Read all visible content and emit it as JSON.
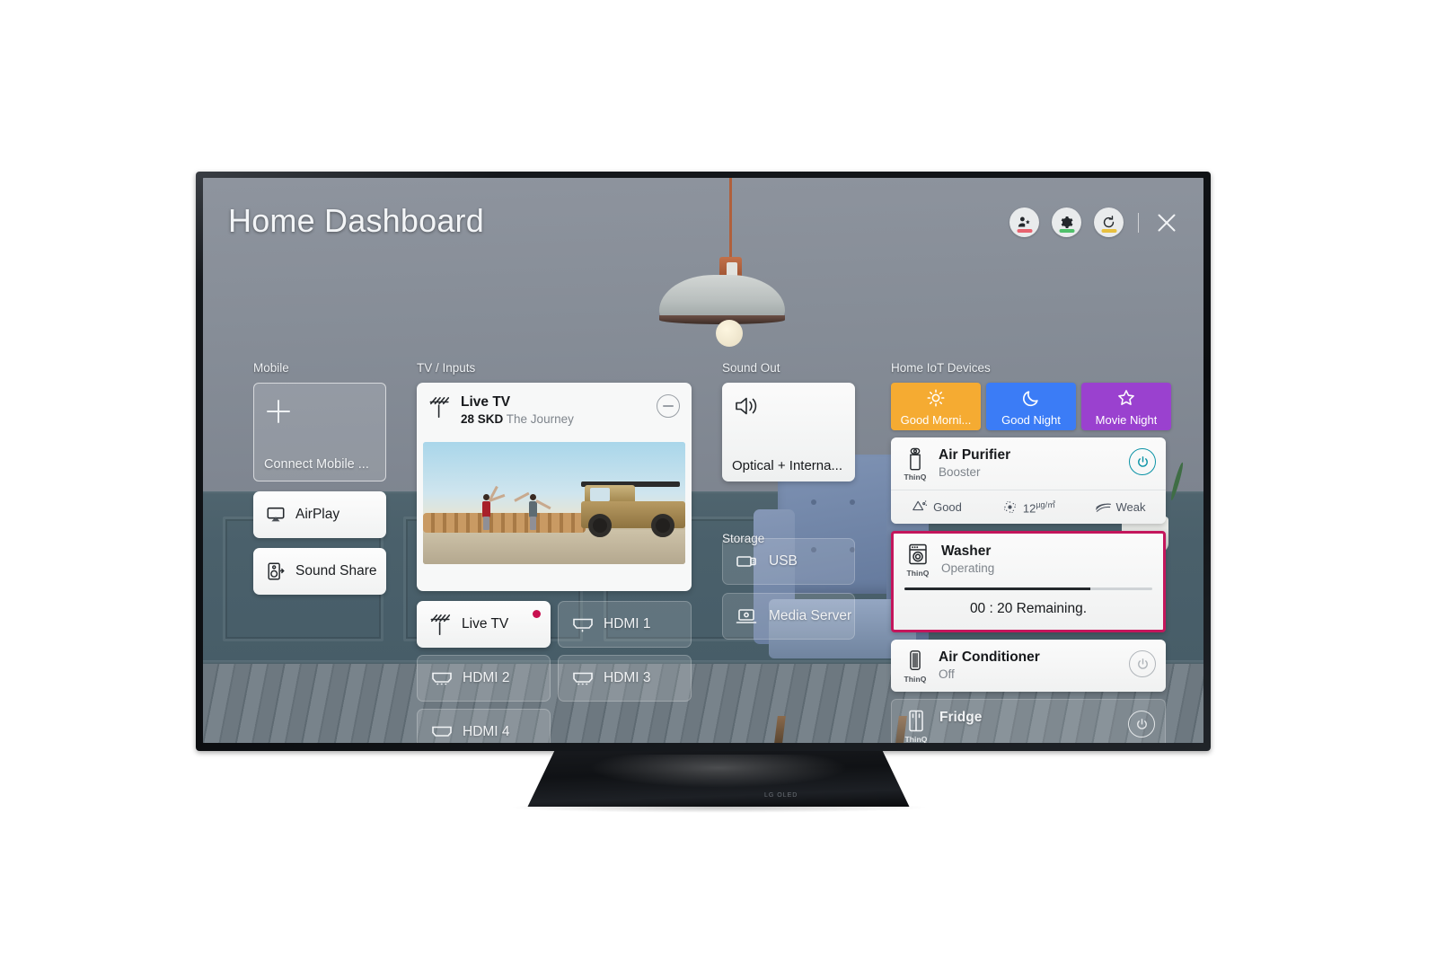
{
  "header": {
    "title": "Home Dashboard",
    "icons": [
      {
        "name": "user-profile-star-icon",
        "accent": "#e8636f"
      },
      {
        "name": "gear-icon",
        "accent": "#4fc06a"
      },
      {
        "name": "rotate-refresh-icon",
        "accent": "#e8c03f"
      }
    ],
    "close_label": "Close"
  },
  "sections": {
    "mobile": {
      "label": "Mobile"
    },
    "tv_inputs": {
      "label": "TV / Inputs"
    },
    "sound_out": {
      "label": "Sound Out"
    },
    "storage": {
      "label": "Storage"
    },
    "home_iot": {
      "label": "Home IoT Devices"
    }
  },
  "mobile": {
    "add_label": "Connect Mobile ...",
    "tiles": [
      {
        "label": "AirPlay",
        "icon": "airplay-icon"
      },
      {
        "label": "Sound Share",
        "icon": "sound-share-icon"
      }
    ]
  },
  "tv": {
    "live_card": {
      "title": "Live TV",
      "channel": "28 SKD",
      "program": "The Journey",
      "remove_label": "Remove"
    },
    "inputs": [
      {
        "label": "Live TV",
        "icon": "antenna-icon",
        "active": true,
        "badge": true
      },
      {
        "label": "HDMI 1",
        "icon": "hdmi-icon",
        "active": false,
        "badge": false
      },
      {
        "label": "HDMI 2",
        "icon": "hdmi-icon",
        "active": false,
        "badge": false
      },
      {
        "label": "HDMI 3",
        "icon": "hdmi-icon",
        "active": false,
        "badge": false
      },
      {
        "label": "HDMI 4",
        "icon": "hdmi-icon",
        "active": false,
        "badge": false
      }
    ]
  },
  "sound_out": {
    "value": "Optical + Interna...",
    "icon": "speaker-icon"
  },
  "storage": {
    "items": [
      {
        "label": "USB",
        "icon": "usb-icon"
      },
      {
        "label": "Media Server",
        "icon": "media-server-icon"
      }
    ]
  },
  "iot": {
    "scenes": [
      {
        "label": "Good Morni...",
        "icon": "sun-icon",
        "color": "#f5ab32"
      },
      {
        "label": "Good Night",
        "icon": "moon-icon",
        "color": "#3b7cf6"
      },
      {
        "label": "Movie Night",
        "icon": "star-icon",
        "color": "#9a41cf"
      }
    ],
    "devices": [
      {
        "name": "Air Purifier",
        "status": "Booster",
        "brand": "ThinQ",
        "icon": "air-purifier-icon",
        "power": "on",
        "stats": [
          {
            "icon": "air-quality-icon",
            "value": "Good"
          },
          {
            "icon": "particle-icon",
            "value": "12",
            "unit": "µg/㎥"
          },
          {
            "icon": "airflow-icon",
            "value": "Weak"
          }
        ]
      },
      {
        "name": "Washer",
        "status": "Operating",
        "brand": "ThinQ",
        "icon": "washer-icon",
        "focused": true,
        "progress_percent": 75,
        "remaining": "00 : 20 Remaining.",
        "focus_color": "#c4165c"
      },
      {
        "name": "Air Conditioner",
        "status": "Off",
        "brand": "ThinQ",
        "icon": "air-conditioner-icon",
        "power": "off"
      },
      {
        "name": "Fridge",
        "brand": "ThinQ",
        "icon": "fridge-icon",
        "power": "off"
      }
    ]
  },
  "device": {
    "brand_mark": "LG OLED"
  }
}
